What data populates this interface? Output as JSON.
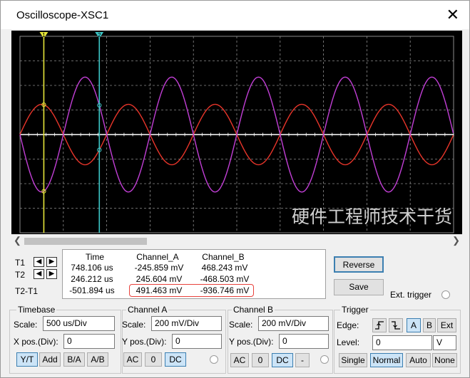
{
  "window": {
    "title": "Oscilloscope-XSC1",
    "close_glyph": "✕"
  },
  "colors": {
    "channel_a": "#e8352a",
    "channel_b": "#c23fd6",
    "cursor_t1": "#e6e63a",
    "cursor_t2": "#3cc6c6",
    "grid": "#8c8c8c",
    "background": "#000000",
    "highlight": "#e8413c"
  },
  "watermark": "硬件工程师技术干货",
  "cursors": {
    "t1_marker": "1",
    "t2_marker": "2"
  },
  "readout": {
    "headers": [
      "Time",
      "Channel_A",
      "Channel_B"
    ],
    "rows": [
      {
        "label": "T1",
        "time": "748.106 us",
        "a": "-245.859 mV",
        "b": "468.243 mV"
      },
      {
        "label": "T2",
        "time": "246.212 us",
        "a": "245.604 mV",
        "b": "-468.503 mV"
      },
      {
        "label": "T2-T1",
        "time": "-501.894 us",
        "a": "491.463 mV",
        "b": "-936.746 mV"
      }
    ]
  },
  "buttons": {
    "reverse": "Reverse",
    "save": "Save",
    "ext_trigger": "Ext. trigger"
  },
  "timebase": {
    "title": "Timebase",
    "scale_label": "Scale:",
    "scale": "500 us/Div",
    "xpos_label": "X pos.(Div):",
    "xpos": "0",
    "modes": [
      "Y/T",
      "Add",
      "B/A",
      "A/B"
    ],
    "active_mode": "Y/T"
  },
  "channel_a": {
    "title": "Channel A",
    "scale_label": "Scale:",
    "scale": "200 mV/Div",
    "ypos_label": "Y pos.(Div):",
    "ypos": "0",
    "coupling": [
      "AC",
      "0",
      "DC"
    ],
    "active": "DC"
  },
  "channel_b": {
    "title": "Channel B",
    "scale_label": "Scale:",
    "scale": "200 mV/Div",
    "ypos_label": "Y pos.(Div):",
    "ypos": "0",
    "coupling": [
      "AC",
      "0",
      "DC",
      "-"
    ],
    "active": "DC"
  },
  "trigger": {
    "title": "Trigger",
    "edge_label": "Edge:",
    "edges": [
      "rising-edge-icon",
      "falling-edge-icon"
    ],
    "sources": [
      "A",
      "B",
      "Ext"
    ],
    "active_source": "A",
    "level_label": "Level:",
    "level": "0",
    "level_unit": "V",
    "modes": [
      "Single",
      "Normal",
      "Auto",
      "None"
    ],
    "active_mode": "Normal"
  },
  "chart_data": {
    "type": "line",
    "xlabel": "",
    "ylabel": "",
    "x_divisions": 10,
    "y_divisions": 8,
    "timebase_us_per_div": 500,
    "volts_mV_per_div": 200,
    "series": [
      {
        "amplitude_mV": 246,
        "period_us": 1000,
        "phase": 0,
        "color": "#e8352a"
      },
      {
        "amplitude_mV": 468,
        "period_us": 1000,
        "phase": 3.14159,
        "color": "#c23fd6"
      }
    ],
    "cursor_t1_x_div": 0.55,
    "cursor_t2_x_div": 1.83
  }
}
